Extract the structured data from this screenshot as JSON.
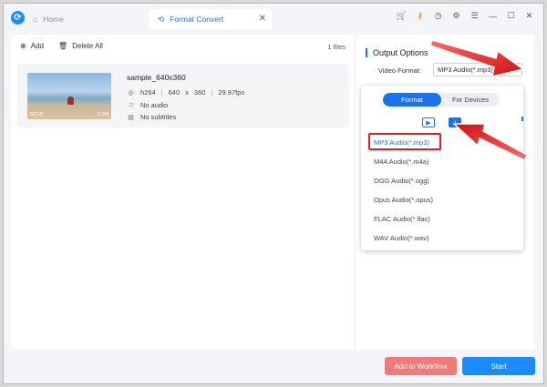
{
  "tabs": [
    {
      "label": "Home",
      "icon": "home-icon"
    },
    {
      "label": "Format Convert",
      "icon": "convert-icon"
    }
  ],
  "toolbar": {
    "add_label": "Add",
    "delete_all_label": "Delete All"
  },
  "file_count": "1 files",
  "file": {
    "name": "sample_640x360",
    "codec": "h264",
    "width": "640",
    "x": "x",
    "height": "360",
    "fps": "29.97fps",
    "audio": "No audio",
    "subtitles": "No subtitles",
    "duration": "00'13\"",
    "size": "0.5M"
  },
  "output": {
    "title": "Output Options",
    "video_format_label": "Video Format:",
    "video_format_value": "MP3 Audio(*.mp3)"
  },
  "format_panel": {
    "tabs": [
      "Format",
      "For Devices"
    ],
    "active_tab": "Format",
    "formats": [
      "MP3 Audio(*.mp3)",
      "M4A Audio(*.m4a)",
      "OGG Audio(*.ogg)",
      "Opus Audio(*.opus)",
      "FLAC Audio(*.flac)",
      "WAV Audio(*.wav)"
    ],
    "selected_format": "MP3 Audio(*.mp3)"
  },
  "buttons": {
    "workflow_label": "Add to Workflow",
    "start_label": "Start"
  },
  "colors": {
    "accent": "#1a73e8",
    "workflow": "#f07a7a",
    "start": "#1a8cff",
    "highlight": "#e02020"
  }
}
